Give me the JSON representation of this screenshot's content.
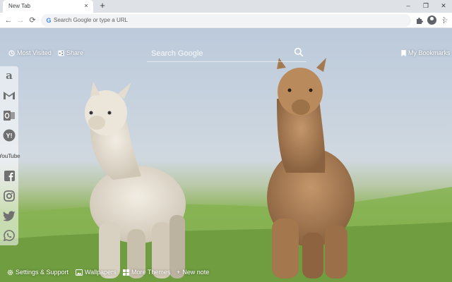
{
  "browser": {
    "tab_title": "New Tab",
    "tab_close": "×",
    "new_tab": "+",
    "window_controls": {
      "minimize": "–",
      "maximize": "❐",
      "close": "✕"
    },
    "nav": {
      "back": "←",
      "forward": "→",
      "reload": "⟳"
    },
    "omnibox": {
      "placeholder": "Search Google or type a URL",
      "value": ""
    },
    "bookmark_star": "☆",
    "menu": "⋮"
  },
  "header": {
    "most_visited": "Most Visited",
    "share": "Share",
    "my_bookmarks": "My Bookmarks"
  },
  "search": {
    "placeholder": "Search Google",
    "value": ""
  },
  "sidebar": {
    "items": [
      {
        "name": "amazon",
        "glyph": "a"
      },
      {
        "name": "gmail",
        "glyph": "M"
      },
      {
        "name": "outlook",
        "glyph": "O"
      },
      {
        "name": "yahoo",
        "glyph": "Y!"
      },
      {
        "name": "youtube",
        "glyph": "YouTube"
      },
      {
        "name": "facebook",
        "glyph": "f"
      },
      {
        "name": "instagram",
        "glyph": ""
      },
      {
        "name": "twitter",
        "glyph": ""
      },
      {
        "name": "whatsapp",
        "glyph": ""
      }
    ]
  },
  "footer": {
    "settings": "Settings & Support",
    "wallpapers": "Wallpapers",
    "more_themes": "More Themes",
    "new_note": "New note"
  },
  "colors": {
    "chrome_bg": "#dee1e6",
    "omnibox_bg": "#f1f3f4",
    "sidebar_icon": "#707070",
    "overlay_text": "#ffffff"
  }
}
